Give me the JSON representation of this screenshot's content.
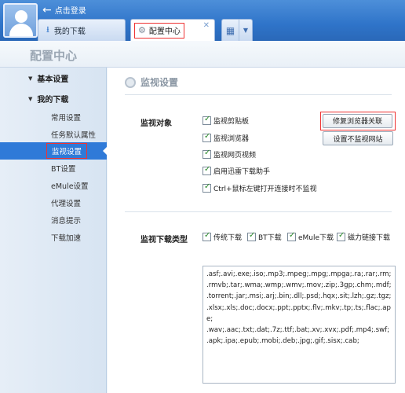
{
  "header": {
    "login_text": "点击登录",
    "tabs": [
      {
        "label": "我的下载"
      },
      {
        "label": "配置中心"
      }
    ],
    "close_glyph": "✕"
  },
  "page": {
    "title": "配置中心"
  },
  "sidebar": {
    "sections": [
      {
        "label": "基本设置"
      },
      {
        "label": "我的下载"
      }
    ],
    "items": [
      {
        "label": "常用设置"
      },
      {
        "label": "任务默认属性"
      },
      {
        "label": "监视设置"
      },
      {
        "label": "BT设置"
      },
      {
        "label": "eMule设置"
      },
      {
        "label": "代理设置"
      },
      {
        "label": "消息提示"
      },
      {
        "label": "下载加速"
      }
    ],
    "active_index": 2
  },
  "main": {
    "heading": "监视设置",
    "monitor_objects": {
      "label": "监视对象",
      "options": [
        {
          "label": "监视剪贴板",
          "checked": true
        },
        {
          "label": "监视浏览器",
          "checked": true
        },
        {
          "label": "监视网页视频",
          "checked": true
        },
        {
          "label": "启用迅雷下载助手",
          "checked": true
        },
        {
          "label": "Ctrl+鼠标左键打开连接时不监视",
          "checked": true
        }
      ],
      "buttons": [
        {
          "label": "修复浏览器关联"
        },
        {
          "label": "设置不监视网站"
        }
      ]
    },
    "download_types": {
      "label": "监视下载类型",
      "options": [
        {
          "label": "传统下载",
          "checked": true
        },
        {
          "label": "BT下载",
          "checked": true
        },
        {
          "label": "eMule下载",
          "checked": true
        },
        {
          "label": "磁力链接下载",
          "checked": true
        }
      ],
      "extensions": ".asf;.avi;.exe;.iso;.mp3;.mpeg;.mpg;.mpga;.ra;.rar;.rm;\n.rmvb;.tar;.wma;.wmp;.wmv;.mov;.zip;.3gp;.chm;.mdf;\n.torrent;.jar;.msi;.arj;.bin;.dll;.psd;.hqx;.sit;.lzh;.gz;.tgz;\n.xlsx;.xls;.doc;.docx;.ppt;.pptx;.flv;.mkv;.tp;.ts;.flac;.ape;\n.wav;.aac;.txt;.dat;.7z;.ttf;.bat;.xv;.xvx;.pdf;.mp4;.swf;\n.apk;.ipa;.epub;.mobi;.deb;.jpg;.gif;.sisx;.cab;"
    }
  }
}
